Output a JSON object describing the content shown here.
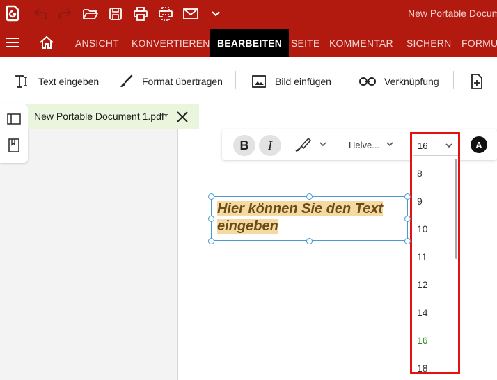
{
  "titlebar": {
    "window_title": "New Portable Docum",
    "brand_color": "#b21a10",
    "quick_access": [
      "undo-icon",
      "redo-icon",
      "open-folder-icon",
      "save-icon",
      "print-icon",
      "scan-icon",
      "mail-icon",
      "chevron-down-icon"
    ]
  },
  "menu": {
    "items": [
      "ANSICHT",
      "KONVERTIEREN",
      "BEARBEITEN",
      "SEITE",
      "KOMMENTAR",
      "SICHERN",
      "FORMU"
    ],
    "active": "BEARBEITEN"
  },
  "toolbar": {
    "text_input": "Text eingeben",
    "format_copy": "Format übertragen",
    "insert_image": "Bild einfügen",
    "link": "Verknüpfung"
  },
  "document_tab": {
    "label": "New Portable Document 1.pdf*"
  },
  "format_bar": {
    "bold": "B",
    "italic": "I",
    "font": "Helve...",
    "size": "16",
    "color_label": "A"
  },
  "font_size_dropdown": {
    "options": [
      "8",
      "9",
      "10",
      "11",
      "12",
      "14",
      "16",
      "18"
    ],
    "selected": "16",
    "selected_color": "#2e8a1f",
    "highlight_color": "#e3110f"
  },
  "textbox": {
    "line1": "Hier können Sie den Text",
    "line2": "eingeben"
  }
}
